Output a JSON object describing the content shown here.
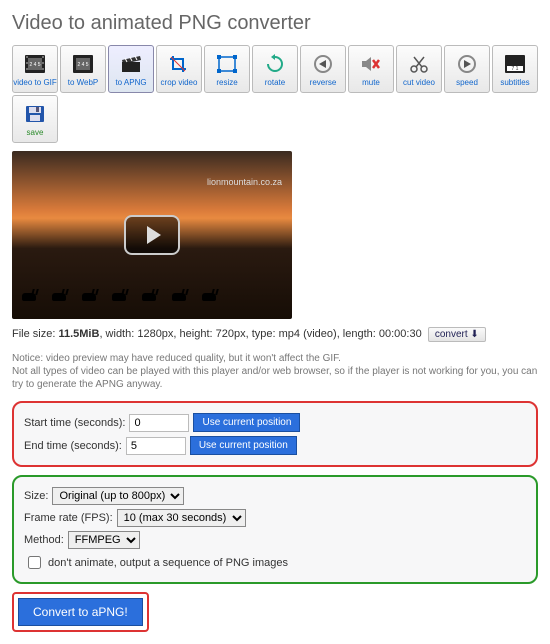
{
  "page": {
    "title": "Video to animated PNG converter"
  },
  "toolbar": {
    "items": [
      {
        "key": "video-to-gif",
        "label": "video to GIF"
      },
      {
        "key": "to-webp",
        "label": "to WebP"
      },
      {
        "key": "to-apng",
        "label": "to APNG"
      },
      {
        "key": "crop-video",
        "label": "crop video"
      },
      {
        "key": "resize",
        "label": "resize"
      },
      {
        "key": "rotate",
        "label": "rotate"
      },
      {
        "key": "reverse",
        "label": "reverse"
      },
      {
        "key": "mute",
        "label": "mute"
      },
      {
        "key": "cut-video",
        "label": "cut video"
      },
      {
        "key": "speed",
        "label": "speed"
      },
      {
        "key": "subtitles",
        "label": "subtitles"
      },
      {
        "key": "save",
        "label": "save"
      }
    ]
  },
  "video": {
    "watermark": "lionmountain.co.za"
  },
  "fileinfo": {
    "prefix": "File size: ",
    "size": "11.5MiB",
    "rest": ", width: 1280px, height: 720px, type: mp4 (video), length: 00:00:30",
    "convert_btn": "convert "
  },
  "notice": "Notice: video preview may have reduced quality, but it won't affect the GIF.\nNot all types of video can be played with this player and/or web browser, so if the player is not working for you, you can try to generate the APNG anyway.",
  "time": {
    "start_label": "Start time (seconds):",
    "start_value": "0",
    "end_label": "End time (seconds):",
    "end_value": "5",
    "use_btn": "Use current position"
  },
  "options": {
    "size_label": "Size:",
    "size_value": "Original (up to 800px)",
    "fps_label": "Frame rate (FPS):",
    "fps_value": "10 (max 30 seconds)",
    "method_label": "Method:",
    "method_value": "FFMPEG",
    "dont_animate": "don't animate, output a sequence of PNG images"
  },
  "convert": {
    "label": "Convert to aPNG!"
  }
}
